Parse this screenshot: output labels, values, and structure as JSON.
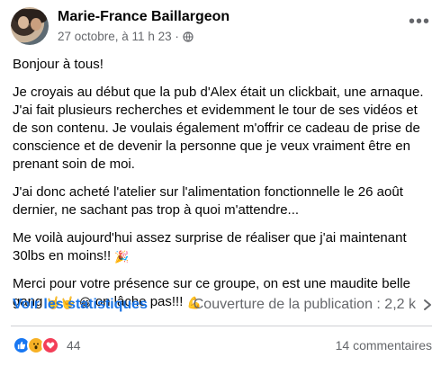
{
  "post": {
    "author": "Marie-France Baillargeon",
    "timestamp": "27 octobre, à 11 h 23 ·",
    "audience_icon": "globe-icon",
    "more_icon": "more-horizontal-icon",
    "paragraphs": [
      "Bonjour à tous!",
      "Je croyais au début que la pub d'Alex était un clickbait, une arnaque. J'ai fait plusieurs recherches et evidemment le tour de ses vidéos et de son contenu. Je voulais également m'offrir ce cadeau de prise de conscience et de devenir la personne que je veux vraiment être en prenant soin de moi.",
      "J'ai donc acheté l'atelier sur l'alimentation fonctionnelle le 26 août dernier, ne sachant pas trop à quoi m'attendre...",
      "Me voilà aujourd'hui assez surprise de réaliser que j'ai maintenant 30lbs en moins!!",
      "Merci pour votre présence sur ce groupe, on est une maudite belle gang",
      "on lâche pas!!!"
    ],
    "emojis": {
      "party": "🎉",
      "hand1": "🤟",
      "hand2": "🤟",
      "smile": "😀",
      "muscle": "💪"
    }
  },
  "insights": {
    "stats_link": "Voir les statistiques",
    "reach_label": "Couverture de la publication : 2,2 k",
    "chevron_icon": "chevron-right-icon"
  },
  "footer": {
    "reactions": [
      "like",
      "wow",
      "love"
    ],
    "reaction_count": "44",
    "comments": "14 commentaires"
  },
  "colors": {
    "link": "#1b74e4",
    "secondary_text": "#65676b",
    "like": "#1877f2",
    "wow": "#f7b125",
    "love": "#f33e58"
  }
}
